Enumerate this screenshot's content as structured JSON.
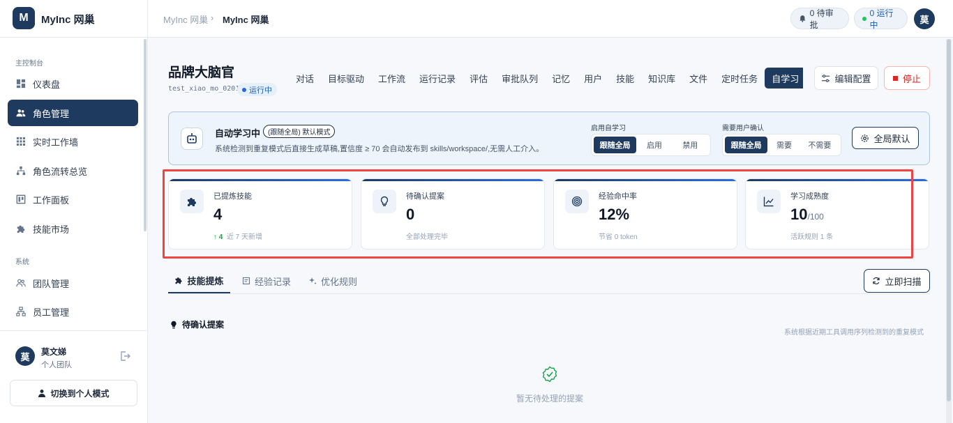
{
  "app": {
    "logo_letter": "M",
    "name": "MyInc 网巢"
  },
  "sidebar": {
    "section_main": "主控制台",
    "items": [
      {
        "label": "仪表盘",
        "icon": "dashboard-icon"
      },
      {
        "label": "角色管理",
        "icon": "users-icon",
        "active": true
      },
      {
        "label": "实时工作墙",
        "icon": "grid-icon"
      },
      {
        "label": "角色流转总览",
        "icon": "hierarchy-icon"
      },
      {
        "label": "工作面板",
        "icon": "board-icon"
      },
      {
        "label": "技能市场",
        "icon": "puzzle-icon"
      }
    ],
    "section_system": "系统",
    "system_items": [
      {
        "label": "团队管理",
        "icon": "team-icon"
      },
      {
        "label": "员工管理",
        "icon": "org-icon"
      }
    ],
    "user": {
      "avatar": "莫",
      "name": "莫文娣",
      "team": "个人团队"
    },
    "switch_label": "切换到个人模式"
  },
  "topbar": {
    "breadcrumb_root": "MyInc 网巢",
    "breadcrumb_sep": "›",
    "breadcrumb_current": "MyInc 网巢",
    "pending_label": "0 待审批",
    "running_label": "0 运行中",
    "avatar": "莫"
  },
  "agent": {
    "title": "品牌大脑官",
    "id": "test_xiao_mo_0201",
    "status": "运行中",
    "tabs": [
      "对话",
      "目标驱动",
      "工作流",
      "运行记录",
      "评估",
      "审批队列",
      "记忆",
      "用户",
      "技能",
      "知识库",
      "文件",
      "定时任务",
      "自学习"
    ],
    "active_tab": "自学习",
    "edit_label": "编辑配置",
    "stop_label": "停止"
  },
  "learning": {
    "title": "自动学习中",
    "mode_tag": "(跟随全局) 默认模式",
    "desc": "系统检测到重复模式后直接生成草稿,置信度 ≥ 70 会自动发布到 skills/workspace/,无需人工介入。",
    "enable_label": "启用自学习",
    "enable_options": [
      "跟随全局",
      "启用",
      "禁用"
    ],
    "enable_selected": "跟随全局",
    "confirm_label": "需要用户确认",
    "confirm_options": [
      "跟随全局",
      "需要",
      "不需要"
    ],
    "confirm_selected": "跟随全局",
    "global_default_label": "全局默认"
  },
  "stats": [
    {
      "label": "已提炼技能",
      "value": "4",
      "unit": "",
      "sub_up": "↑ 4",
      "sub": "近 7 天新增",
      "icon": "puzzle-icon"
    },
    {
      "label": "待确认提案",
      "value": "0",
      "unit": "",
      "sub_up": "",
      "sub": "全部处理完毕",
      "icon": "lightbulb-icon"
    },
    {
      "label": "经验命中率",
      "value": "12%",
      "unit": "",
      "sub_up": "",
      "sub": "节省 0 token",
      "icon": "target-icon"
    },
    {
      "label": "学习成熟度",
      "value": "10",
      "unit": "/100",
      "sub_up": "",
      "sub": "活跃规则 1 条",
      "icon": "trend-icon"
    }
  ],
  "subtabs": {
    "items": [
      "技能提炼",
      "经验记录",
      "优化规则"
    ],
    "active": "技能提炼",
    "scan_label": "立即扫描"
  },
  "pending": {
    "title": "待确认提案",
    "desc": "系统根据近期工具调用序列检测到的重复模式",
    "empty_text": "暂无待处理的提案"
  },
  "colors": {
    "primary": "#1e3a5f",
    "accent": "#2d6cdf",
    "danger": "#dc2626",
    "success": "#16a34a",
    "highlight": "#ef4444"
  }
}
